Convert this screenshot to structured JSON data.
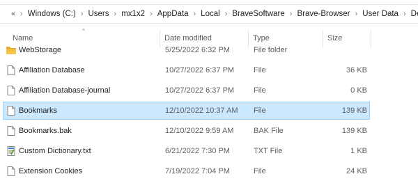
{
  "address_bar": {
    "overflow": "«",
    "path": [
      "Windows (C:)",
      "Users",
      "mx1x2",
      "AppData",
      "Local",
      "BraveSoftware",
      "Brave-Browser",
      "User Data",
      "Default"
    ]
  },
  "columns": {
    "name": "Name",
    "date": "Date modified",
    "type": "Type",
    "size": "Size",
    "sort_indicator": "^"
  },
  "files": [
    {
      "name": "WebStorage",
      "date": "5/25/2022 6:32 PM",
      "type": "File folder",
      "size": "",
      "icon": "folder-icon"
    },
    {
      "name": "Affiliation Database",
      "date": "10/27/2022 6:37 PM",
      "type": "File",
      "size": "36 KB",
      "icon": "file-icon"
    },
    {
      "name": "Affiliation Database-journal",
      "date": "10/27/2022 6:37 PM",
      "type": "File",
      "size": "0 KB",
      "icon": "file-icon"
    },
    {
      "name": "Bookmarks",
      "date": "12/10/2022 10:37 AM",
      "type": "File",
      "size": "139 KB",
      "icon": "file-icon",
      "selected": true
    },
    {
      "name": "Bookmarks.bak",
      "date": "12/10/2022 9:59 AM",
      "type": "BAK File",
      "size": "139 KB",
      "icon": "file-icon"
    },
    {
      "name": "Custom Dictionary.txt",
      "date": "6/21/2022 7:30 PM",
      "type": "TXT File",
      "size": "1 KB",
      "icon": "text-file-icon"
    },
    {
      "name": "Extension Cookies",
      "date": "7/19/2022 7:04 PM",
      "type": "File",
      "size": "24 KB",
      "icon": "file-icon"
    }
  ],
  "colors": {
    "selection": "#cce8ff",
    "selection_border": "#99d1ff",
    "folder": "#f6c344"
  }
}
